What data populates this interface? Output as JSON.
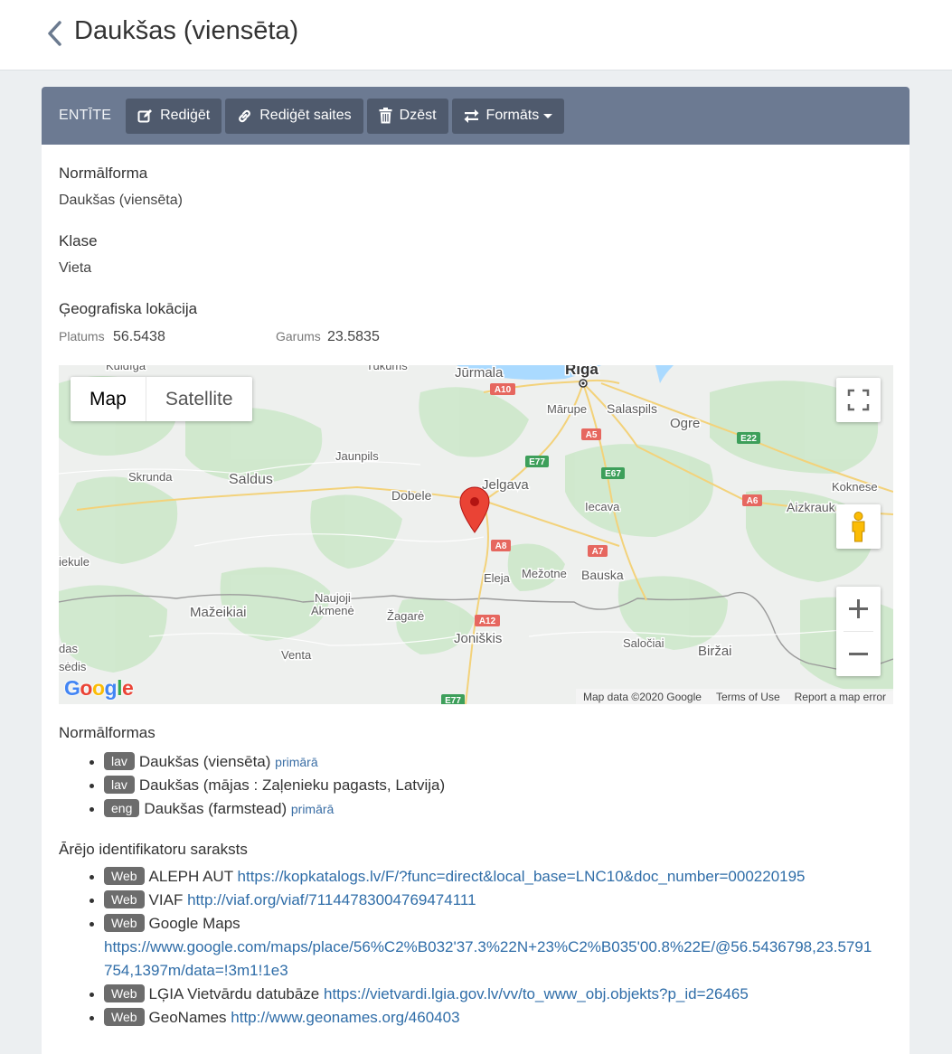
{
  "page": {
    "title": "Daukšas (viensēta)"
  },
  "toolbar": {
    "label": "ENTĪTE",
    "edit": "Rediģēt",
    "edit_links": "Rediģēt saites",
    "delete": "Dzēst",
    "formats": "Formāts"
  },
  "fields": {
    "normal_form_label": "Normālforma",
    "normal_form_value": "Daukšas (viensēta)",
    "class_label": "Klase",
    "class_value": "Vieta",
    "geo_label": "Ģeografiska lokācija",
    "lat_label": "Platums",
    "lat_value": "56.5438",
    "lon_label": "Garums",
    "lon_value": "23.5835"
  },
  "map": {
    "type_map": "Map",
    "type_satellite": "Satellite",
    "logo": "Google",
    "attrib_data": "Map data ©2020 Google",
    "attrib_terms": "Terms of Use",
    "attrib_report": "Report a map error",
    "places": {
      "kuldiga": "Kuldīga",
      "tukums": "Tukums",
      "jurmala": "Jūrmala",
      "riga": "Rīga",
      "marupe": "Mārupe",
      "salaspils": "Salaspils",
      "ogre": "Ogre",
      "jaunpils": "Jaunpils",
      "skrunda": "Skrunda",
      "saldus": "Saldus",
      "dobele": "Dobele",
      "jelgava": "Jelgava",
      "koknese": "Koknese",
      "iecava": "Iecava",
      "aizkraukle": "Aizkrauk",
      "eleja": "Eleja",
      "mezotne": "Mežotne",
      "bauska": "Bauska",
      "naujoji": "Naujoji",
      "akmene": "Akmenė",
      "mazeikiai": "Mažeikiai",
      "zagare": "Žagarė",
      "joniskis": "Joniškis",
      "venta": "Venta",
      "saloiciai": "Saločiai",
      "birzai": "Biržai",
      "iekule": "iekule",
      "sedis": "sėdis",
      "das": "das"
    },
    "roads": {
      "a10": "A10",
      "a5": "A5",
      "e77": "E77",
      "e67": "E67",
      "e22": "E22",
      "a6": "A6",
      "a8": "A8",
      "a7": "A7",
      "a12": "A12",
      "e77b": "E77"
    }
  },
  "normal_forms": {
    "heading": "Normālformas",
    "items": [
      {
        "lang": "lav",
        "text": "Daukšas (viensēta)",
        "flag": "primārā"
      },
      {
        "lang": "lav",
        "text": "Daukšas (mājas : Zaļenieku pagasts, Latvija)",
        "flag": ""
      },
      {
        "lang": "eng",
        "text": "Daukšas (farmstead)",
        "flag": "primārā"
      }
    ]
  },
  "identifiers": {
    "heading": "Ārējo identifikatoru saraksts",
    "items": [
      {
        "badge": "Web",
        "name": "ALEPH AUT",
        "url": "https://kopkatalogs.lv/F/?func=direct&local_base=LNC10&doc_number=000220195"
      },
      {
        "badge": "Web",
        "name": "VIAF",
        "url": "http://viaf.org/viaf/71144783004769474111"
      },
      {
        "badge": "Web",
        "name": "Google Maps",
        "url_line1": "https://www.google.com/maps/place/56%C2%B032'37.3%22N+23%C2%B035'00.8%22E/@56.5436798,23.5791",
        "url_line2": "754,1397m/data=!3m1!1e3"
      },
      {
        "badge": "Web",
        "name": "LĢIA Vietvārdu datubāze",
        "url": "https://vietvardi.lgia.gov.lv/vv/to_www_obj.objekts?p_id=26465"
      },
      {
        "badge": "Web",
        "name": "GeoNames",
        "url": "http://www.geonames.org/460403"
      }
    ]
  }
}
